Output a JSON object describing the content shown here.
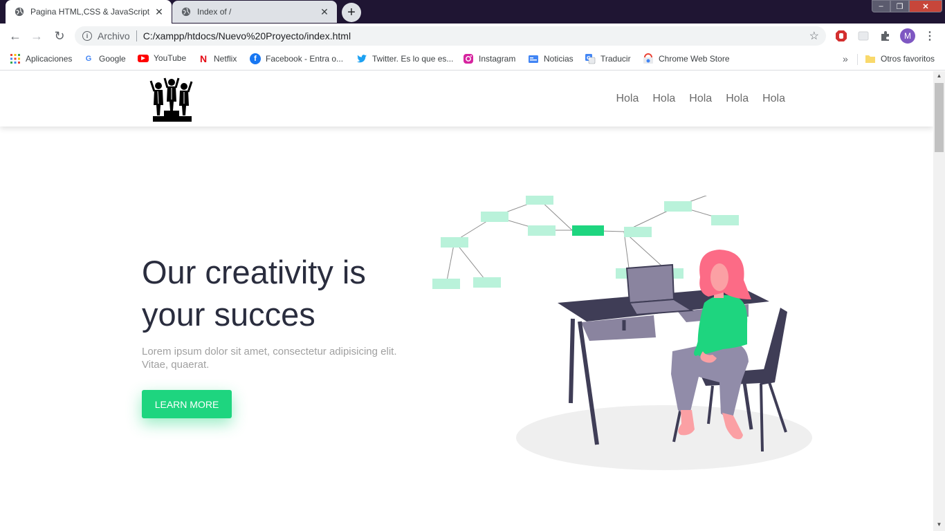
{
  "browser": {
    "tabs": [
      {
        "title": "Pagina HTML,CSS & JavaScript",
        "active": true
      },
      {
        "title": "Index of /",
        "active": false
      }
    ],
    "new_tab_label": "+",
    "window_controls": {
      "minimize": "–",
      "maximize": "❐",
      "close": "✕"
    },
    "address": {
      "scheme_label": "Archivo",
      "url": "C:/xampp/htdocs/Nuevo%20Proyecto/index.html"
    },
    "profile_initial": "M",
    "bookmarks": [
      {
        "label": "Aplicaciones",
        "icon": "apps-grid-icon"
      },
      {
        "label": "Google",
        "icon": "google-icon"
      },
      {
        "label": "YouTube",
        "icon": "youtube-icon"
      },
      {
        "label": "Netflix",
        "icon": "netflix-icon"
      },
      {
        "label": "Facebook - Entra o...",
        "icon": "facebook-icon"
      },
      {
        "label": "Twitter. Es lo que es...",
        "icon": "twitter-icon"
      },
      {
        "label": "Instagram",
        "icon": "instagram-icon"
      },
      {
        "label": "Noticias",
        "icon": "news-icon"
      },
      {
        "label": "Traducir",
        "icon": "translate-icon"
      },
      {
        "label": "Chrome Web Store",
        "icon": "webstore-icon"
      }
    ],
    "bookmarks_overflow": "»",
    "other_bookmarks": "Otros favoritos"
  },
  "page": {
    "nav": [
      "Hola",
      "Hola",
      "Hola",
      "Hola",
      "Hola"
    ],
    "hero": {
      "title_line1": "Our creativity is",
      "title_line2": "your succes",
      "description": "Lorem ipsum dolor sit amet, consectetur adipisicing elit. Vitae, quaerat.",
      "cta_label": "LEARN MORE"
    }
  },
  "colors": {
    "accent": "#1ed57f",
    "title_text": "#2a2d3e",
    "muted_text": "#a0a0a0",
    "nav_text": "#6b6b6b",
    "chrome_dark": "#1f1533"
  }
}
